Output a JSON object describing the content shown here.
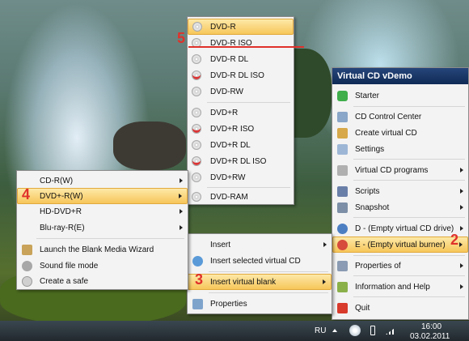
{
  "vcd_menu": {
    "title": "Virtual CD vDemo",
    "items": [
      {
        "label": "Starter",
        "icon": "starter-icon"
      },
      {
        "label": "CD Control Center",
        "icon": "control-center-icon"
      },
      {
        "label": "Create virtual CD",
        "icon": "create-cd-icon"
      },
      {
        "label": "Settings",
        "icon": "settings-icon"
      },
      {
        "label": "Virtual CD programs",
        "icon": "programs-icon"
      },
      {
        "label": "Scripts",
        "icon": "scripts-icon"
      },
      {
        "label": "Snapshot",
        "icon": "snapshot-icon"
      },
      {
        "label": "D - (Empty virtual CD drive)",
        "icon": "cd-drive-icon"
      },
      {
        "label": "E - (Empty virtual burner)",
        "icon": "burner-icon"
      },
      {
        "label": "Properties of",
        "icon": "properties-icon"
      },
      {
        "label": "Information and Help",
        "icon": "help-icon"
      },
      {
        "label": "Quit",
        "icon": "quit-icon"
      }
    ]
  },
  "burner_menu": {
    "items": [
      {
        "label": "Insert"
      },
      {
        "label": "Insert selected virtual CD"
      },
      {
        "label": "Insert virtual blank"
      },
      {
        "label": "Properties"
      }
    ]
  },
  "dvd_menu": {
    "items": [
      "DVD-R",
      "DVD-R ISO",
      "DVD-R DL",
      "DVD-R DL ISO",
      "DVD-RW",
      "DVD+R",
      "DVD+R ISO",
      "DVD+R DL",
      "DVD+R DL ISO",
      "DVD+RW",
      "DVD-RAM"
    ]
  },
  "blank_menu": {
    "items": [
      {
        "label": "CD-R(W)"
      },
      {
        "label": "DVD+-R(W)"
      },
      {
        "label": "HD-DVD+R"
      },
      {
        "label": "Blu-ray-R(E)"
      },
      {
        "label": "Launch the Blank Media Wizard"
      },
      {
        "label": "Sound file mode"
      },
      {
        "label": "Create a safe"
      }
    ]
  },
  "step_numbers": [
    "1",
    "2",
    "3",
    "4",
    "5"
  ],
  "taskbar": {
    "language": "RU",
    "time": "16:00",
    "date": "03.02.2011"
  },
  "colors": {
    "highlight": "#f7c65a",
    "step_number": "#e0312a",
    "title_bar": "#1c3a6b"
  }
}
